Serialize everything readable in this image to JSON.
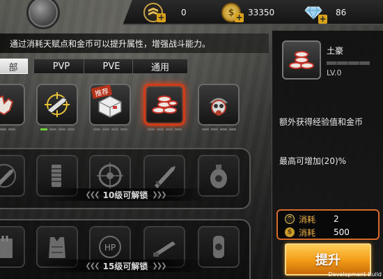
{
  "currencies": [
    {
      "name": "rank-points",
      "icon": "rank-chevron-icon",
      "value": "0"
    },
    {
      "name": "gold",
      "icon": "gold-coin-icon",
      "value": "33350"
    },
    {
      "name": "diamonds",
      "icon": "diamond-icon",
      "value": "86"
    }
  ],
  "description": "通过消耗天赋点和金币可以提升属性，增强战斗能力。",
  "tabs": [
    {
      "label": "全部",
      "visible_text": "部",
      "active": true
    },
    {
      "label": "PVP",
      "active": false
    },
    {
      "label": "PVE",
      "active": false
    },
    {
      "label": "通用",
      "active": false
    }
  ],
  "talent_rows": [
    {
      "locked": false,
      "items": [
        {
          "icon": "glove-icon"
        },
        {
          "icon": "rifle-crosshair-icon",
          "level": 1
        },
        {
          "icon": "supply-crate-icon",
          "badge": "推荐"
        },
        {
          "icon": "coin-stack-icon",
          "selected": true
        },
        {
          "icon": "gas-mask-helmet-icon"
        }
      ]
    },
    {
      "locked": true,
      "unlock_text": "10级可解锁",
      "items": [
        {
          "icon": "bullet-icon"
        },
        {
          "icon": "magazine-icon"
        },
        {
          "icon": "target-reticle-icon"
        },
        {
          "icon": "knife-icon"
        },
        {
          "icon": "biohazard-grenade-icon"
        }
      ]
    },
    {
      "locked": true,
      "unlock_text": "15级可解锁",
      "items": [
        {
          "icon": "ammo-box-icon"
        },
        {
          "icon": "armor-vest-icon"
        },
        {
          "icon": "hp-heart-icon"
        },
        {
          "icon": "blade-icon"
        },
        {
          "icon": "biohazard-canister-icon"
        }
      ]
    }
  ],
  "detail": {
    "name": "土豪",
    "level": "LV.0",
    "effect": "额外获得经验值和金币",
    "max_bonus": "最高可增加(20)%"
  },
  "cost": {
    "talent_label": "消耗",
    "talent_value": "2",
    "gold_label": "消耗",
    "gold_value": "500"
  },
  "upgrade_label": "提升",
  "dev_build": "Development Build",
  "colors": {
    "selected_border": "#d33a18",
    "cost_label": "#f2b245",
    "upgrade_button": "#f29a16",
    "pip_active": "#6fd23a"
  }
}
